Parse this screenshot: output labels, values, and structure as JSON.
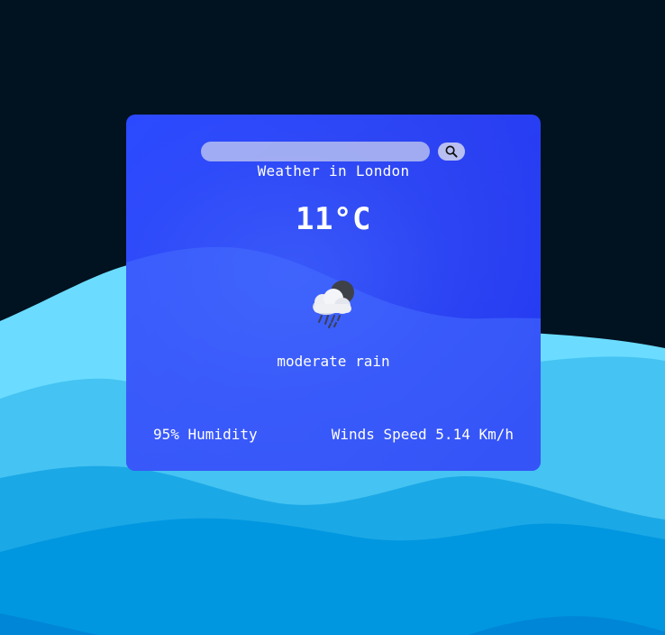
{
  "search": {
    "value": "",
    "placeholder": "",
    "button_icon": "search-icon"
  },
  "weather": {
    "title": "Weather in London",
    "temperature": "11°C",
    "icon": "cloud-rain-moon-icon",
    "description": "moderate rain",
    "humidity": "95% Humidity",
    "wind": "Winds Speed 5.14 Km/h"
  },
  "colors": {
    "background": "#011220",
    "card": "#2a40f2",
    "wave_light": "#6bdcff",
    "wave_mid": "#45c3f2",
    "wave_deep": "#1ba8e6",
    "wave_deepest": "#0097e0"
  }
}
